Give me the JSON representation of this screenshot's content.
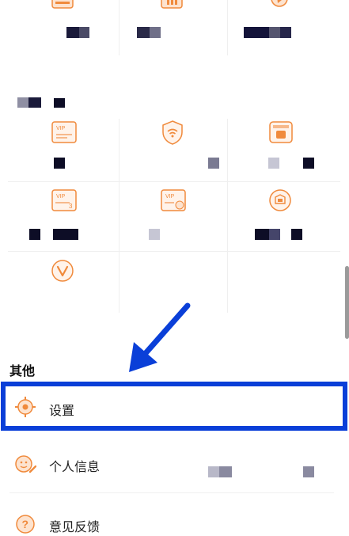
{
  "section_other": {
    "title": "其他"
  },
  "menu": {
    "settings": {
      "label": "设置"
    },
    "personal_info": {
      "label": "个人信息"
    },
    "feedback": {
      "label": "意见反馈"
    }
  },
  "grid_icons": {
    "row0": [
      "card-icon",
      "bar-chart-icon",
      "sports-icon"
    ],
    "row1": [
      "vip-card-icon",
      "wifi-shield-icon",
      "gift-box-icon"
    ],
    "row2": [
      "vip-card-3-icon",
      "vip-card-month-icon",
      "badge-icon"
    ],
    "row3": [
      "v-circle-icon"
    ]
  },
  "colors": {
    "accent_orange": "#f08a3c",
    "highlight_blue": "#0a3fd8",
    "redact_dark": "#1a1a3a",
    "redact_gray": "#8f8fa3"
  }
}
